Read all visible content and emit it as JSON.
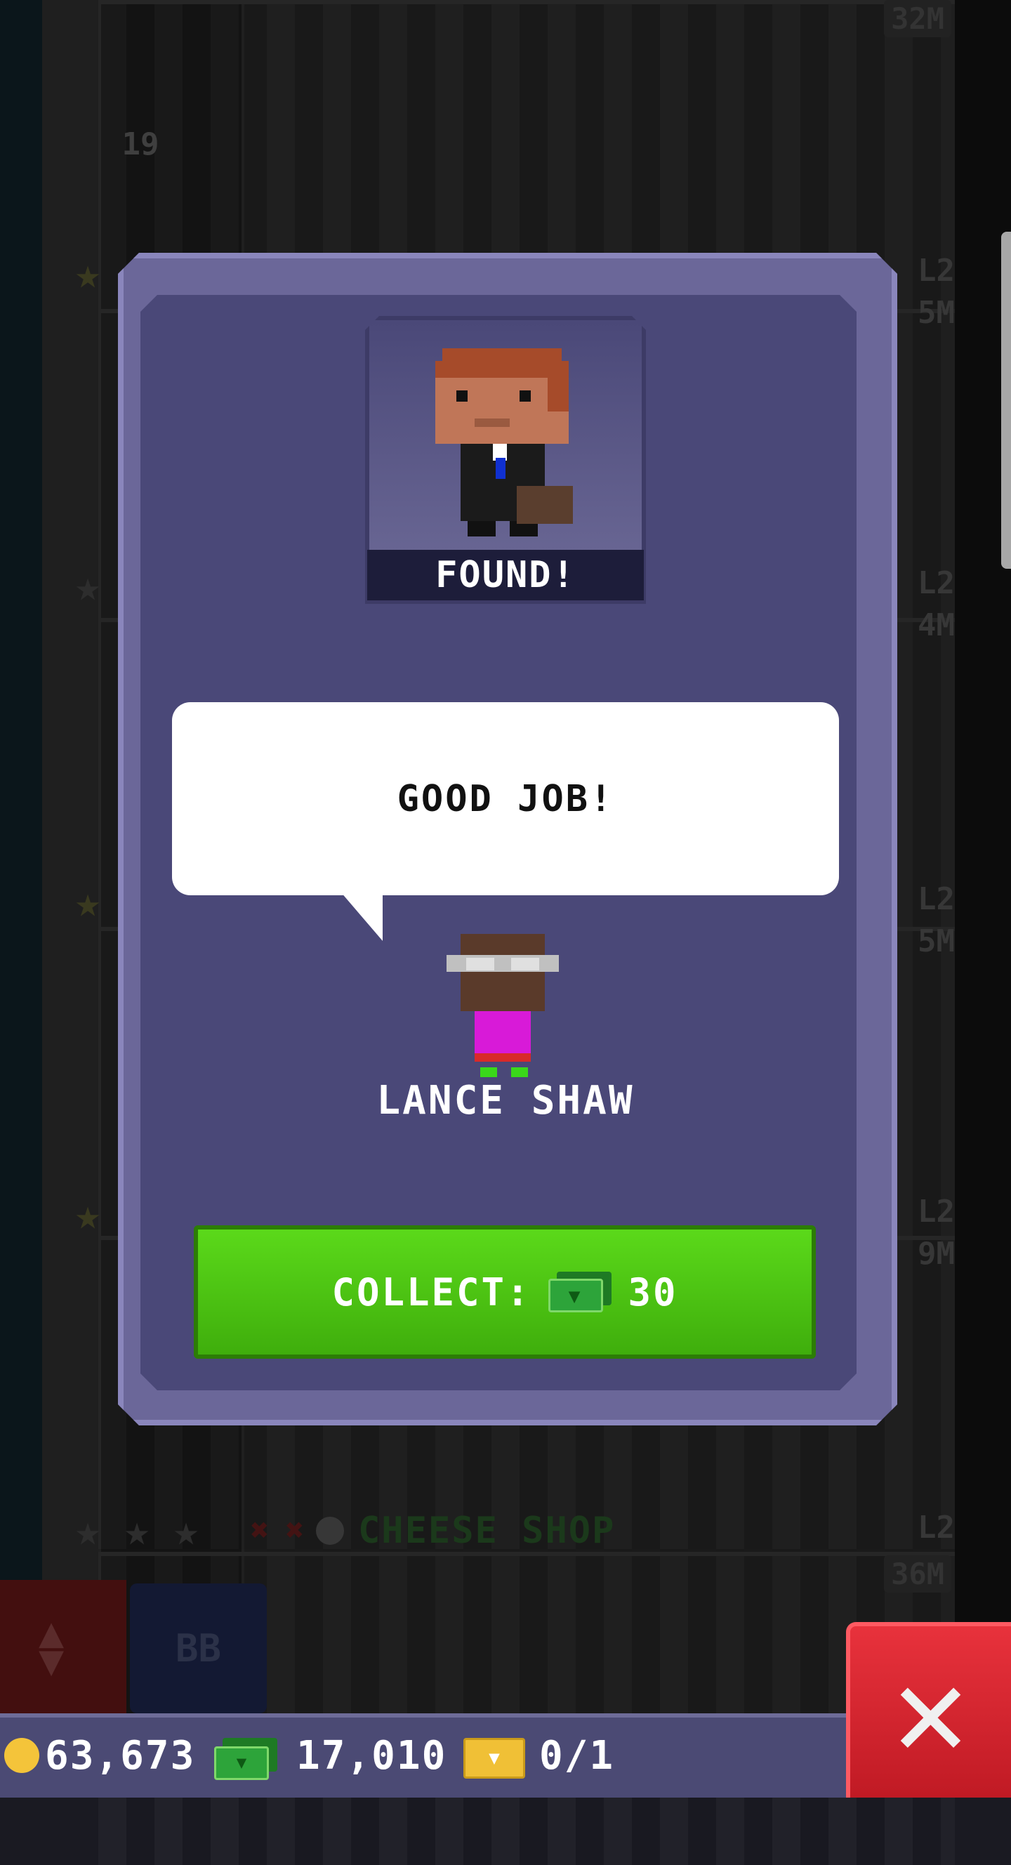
{
  "background": {
    "floor_number": "19",
    "floor_levels": [
      "L2",
      "L2",
      "L2",
      "L2"
    ],
    "floor_prices": [
      "5M",
      "4M",
      "5M",
      "9M"
    ],
    "top_price": "32M",
    "cheese_shop": {
      "label": "CHEESE SHOP",
      "level": "L2",
      "price": "36M"
    },
    "bb_button": "BB"
  },
  "dialog": {
    "badge": "FOUND!",
    "speech": "GOOD JOB!",
    "character_name": "LANCE SHAW",
    "collect_label": "COLLECT:",
    "collect_amount": "30",
    "currency_icon": "bux-icon"
  },
  "statusbar": {
    "coins": "63,673",
    "bux": "17,010",
    "tickets": "0/1"
  },
  "colors": {
    "dialog_frame": "#6b6799",
    "dialog_inner": "#4a4878",
    "collect_green": "#4cc414",
    "close_red": "#d9222c"
  }
}
